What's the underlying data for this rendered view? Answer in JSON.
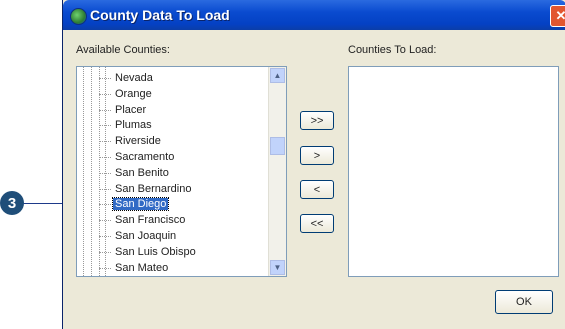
{
  "callout": {
    "number": "3"
  },
  "window": {
    "title": "County Data To Load",
    "close_glyph": "✕"
  },
  "available": {
    "label": "Available Counties:",
    "items": [
      "Nevada",
      "Orange",
      "Placer",
      "Plumas",
      "Riverside",
      "Sacramento",
      "San Benito",
      "San Bernardino",
      "San Diego",
      "San Francisco",
      "San Joaquin",
      "San Luis Obispo",
      "San Mateo"
    ],
    "selected": "San Diego"
  },
  "toload": {
    "label": "Counties To Load:",
    "items": []
  },
  "buttons": {
    "add_all": ">>",
    "add": ">",
    "remove": "<",
    "remove_all": "<<",
    "ok": "OK"
  },
  "scrollbar": {
    "up": "▲",
    "down": "▼"
  },
  "colors": {
    "title_bar": "#0a4bd0",
    "selection": "#316ac5",
    "callout": "#1f4e79"
  }
}
